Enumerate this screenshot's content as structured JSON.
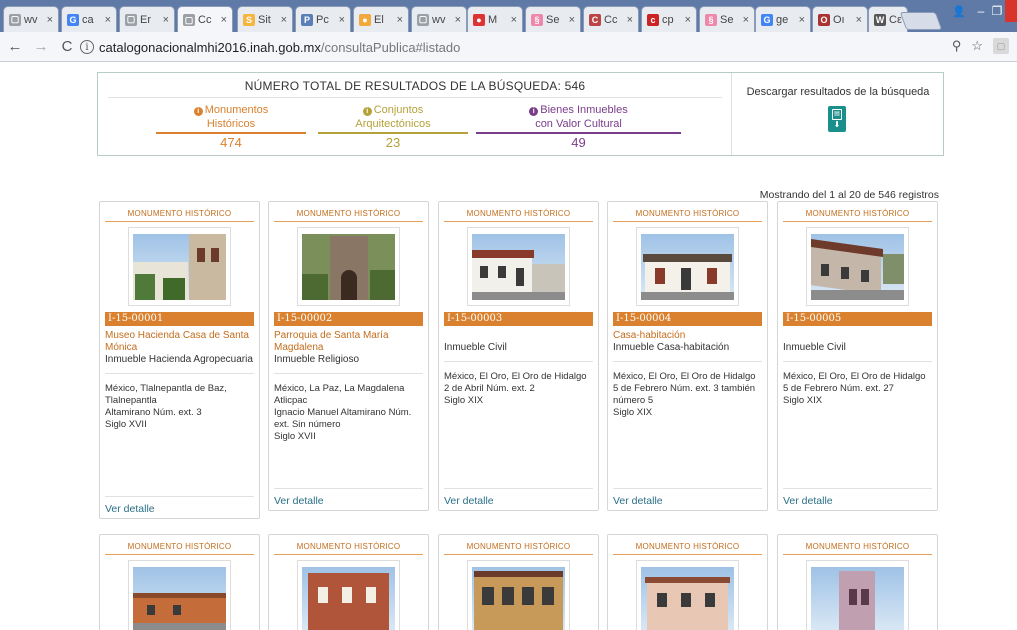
{
  "browser": {
    "tabs": [
      {
        "title": "wv",
        "fav_color": "#9aa0a6",
        "fav_glyph": "▢"
      },
      {
        "title": "ca",
        "fav_color": "#4285f4",
        "fav_glyph": "G"
      },
      {
        "title": "Er",
        "fav_color": "#9aa0a6",
        "fav_glyph": "▢"
      },
      {
        "title": "Cc",
        "fav_color": "#9aa0a6",
        "fav_glyph": "▢"
      },
      {
        "title": "Sit",
        "fav_color": "#f5b53e",
        "fav_glyph": "S"
      },
      {
        "title": "Pc",
        "fav_color": "#5a7fb8",
        "fav_glyph": "P"
      },
      {
        "title": "El",
        "fav_color": "#f2a93b",
        "fav_glyph": "●"
      },
      {
        "title": "wv",
        "fav_color": "#9aa0a6",
        "fav_glyph": "▢"
      },
      {
        "title": "M",
        "fav_color": "#d33",
        "fav_glyph": "●"
      },
      {
        "title": "Se",
        "fav_color": "#e8a",
        "fav_glyph": "§"
      },
      {
        "title": "Cc",
        "fav_color": "#b44",
        "fav_glyph": "C"
      },
      {
        "title": "cp",
        "fav_color": "#c22",
        "fav_glyph": "c"
      },
      {
        "title": "Se",
        "fav_color": "#e8a",
        "fav_glyph": "§"
      },
      {
        "title": "ge",
        "fav_color": "#4285f4",
        "fav_glyph": "G"
      },
      {
        "title": "Oı",
        "fav_color": "#a33",
        "fav_glyph": "O"
      },
      {
        "title": "Cε",
        "fav_color": "#555",
        "fav_glyph": "W"
      }
    ],
    "close_glyph": "×",
    "url_host": "catalogonacionalmhi2016.inah.gob.mx",
    "url_path": "/consultaPublica#listado",
    "back_glyph": "←",
    "forward_glyph": "→",
    "reload_glyph": "C",
    "info_glyph": "i",
    "zoom_glyph": "⚲",
    "star_glyph": "☆",
    "minimize_glyph": "–",
    "restore_glyph": "❐",
    "user_glyph": "👤"
  },
  "summary": {
    "total_label": "NÚMERO TOTAL DE RESULTADOS DE LA BÚSQUEDA: 546",
    "categories": [
      {
        "label_line1": "Monumentos",
        "label_line2": "Históricos",
        "count": "474",
        "color": "#d9812e"
      },
      {
        "label_line1": "Conjuntos",
        "label_line2": "Arquitectónicos",
        "count": "23",
        "color": "#b5a13a"
      },
      {
        "label_line1": "Bienes Inmuebles",
        "label_line2": "con Valor Cultural",
        "count": "49",
        "color": "#7a3d8a"
      }
    ],
    "download_label": "Descargar resultados de la búsqueda",
    "pdf_glyph": "PDF",
    "download_glyph": "⬇"
  },
  "showing_text": "Mostrando del 1 al 20 de 546 registros",
  "cards": [
    {
      "type": "MONUMENTO HISTÓRICO",
      "code": "I-15-00001",
      "name": "Museo Hacienda Casa de Santa Mónica",
      "kind": "Inmueble Hacienda Agropecuaria",
      "address_lines": [
        "México, Tlalnepantla de Baz, Tlalnepantla",
        "Altamirano Núm. ext. 3",
        "Siglo XVII"
      ],
      "detail": "Ver detalle"
    },
    {
      "type": "MONUMENTO HISTÓRICO",
      "code": "I-15-00002",
      "name": "Parroquia de Santa María Magdalena",
      "kind": "Inmueble Religioso",
      "address_lines": [
        "México, La Paz, La Magdalena Atlicpac",
        "Ignacio Manuel Altamirano Núm. ext. Sin número",
        "Siglo XVII"
      ],
      "detail": "Ver detalle"
    },
    {
      "type": "MONUMENTO HISTÓRICO",
      "code": "I-15-00003",
      "name": "",
      "kind": "Inmueble Civil",
      "address_lines": [
        "México, El Oro, El Oro de Hidalgo",
        "2 de Abril Núm. ext. 2",
        "Siglo XIX"
      ],
      "detail": "Ver detalle"
    },
    {
      "type": "MONUMENTO HISTÓRICO",
      "code": "I-15-00004",
      "name": "Casa-habitación",
      "kind": "Inmueble Casa-habitación",
      "address_lines": [
        "México, El Oro, El Oro de Hidalgo",
        "5 de Febrero Núm. ext. 3 también número 5",
        "Siglo XIX"
      ],
      "detail": "Ver detalle"
    },
    {
      "type": "MONUMENTO HISTÓRICO",
      "code": "I-15-00005",
      "name": "",
      "kind": "Inmueble Civil",
      "address_lines": [
        "México, El Oro, El Oro de Hidalgo",
        "5 de Febrero Núm. ext. 27",
        "Siglo XIX"
      ],
      "detail": "Ver detalle"
    }
  ],
  "cards_row2": [
    {
      "type": "MONUMENTO HISTÓRICO"
    },
    {
      "type": "MONUMENTO HISTÓRICO"
    },
    {
      "type": "MONUMENTO HISTÓRICO"
    },
    {
      "type": "MONUMENTO HISTÓRICO"
    },
    {
      "type": "MONUMENTO HISTÓRICO"
    }
  ]
}
